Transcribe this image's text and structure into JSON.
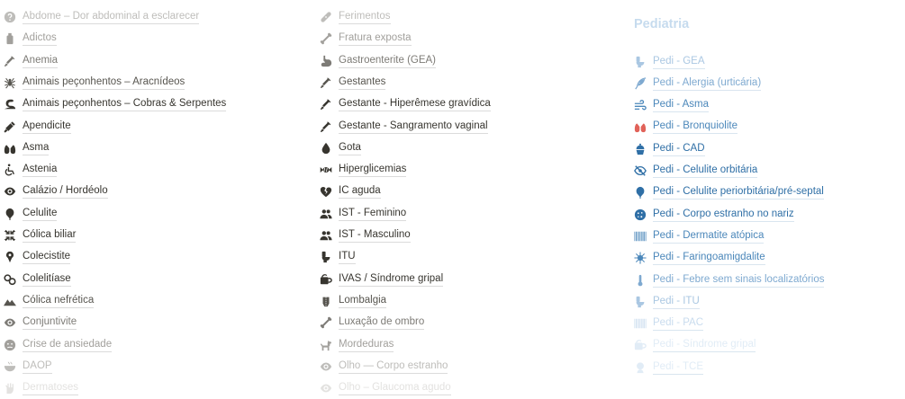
{
  "columns": [
    {
      "items": [
        {
          "label": "Abdome – Dor abdominal a esclarecer",
          "icon": "help-circle-icon"
        },
        {
          "label": "Adictos",
          "icon": "bottle-icon"
        },
        {
          "label": "Anemia",
          "icon": "syringe-icon"
        },
        {
          "label": "Animais peçonhentos – Aracnídeos",
          "icon": "spider-icon"
        },
        {
          "label": "Animais peçonhentos – Cobras & Serpentes",
          "icon": "snake-icon"
        },
        {
          "label": "Apendicite",
          "icon": "stethoscope-icon"
        },
        {
          "label": "Asma",
          "icon": "lungs-icon"
        },
        {
          "label": "Astenia",
          "icon": "wheelchair-icon"
        },
        {
          "label": "Calázio / Hordéolo",
          "icon": "eye-icon"
        },
        {
          "label": "Celulite",
          "icon": "balloon-icon"
        },
        {
          "label": "Cólica biliar",
          "icon": "compress-icon"
        },
        {
          "label": "Colecistite",
          "icon": "pin-icon"
        },
        {
          "label": "Colelitíase",
          "icon": "stones-icon"
        },
        {
          "label": "Cólica nefrética",
          "icon": "mountains-icon"
        },
        {
          "label": "Conjuntivite",
          "icon": "eye-icon"
        },
        {
          "label": "Crise de ansiedade",
          "icon": "face-icon"
        },
        {
          "label": "DAOP",
          "icon": "basin-icon"
        },
        {
          "label": "Dermatoses",
          "icon": "hand-icon"
        }
      ]
    },
    {
      "items": [
        {
          "label": "Ferimentos",
          "icon": "bandage-icon"
        },
        {
          "label": "Fratura exposta",
          "icon": "bone-icon"
        },
        {
          "label": "Gastroenterite (GEA)",
          "icon": "stomach-icon"
        },
        {
          "label": "Gestantes",
          "icon": "syringe-icon"
        },
        {
          "label": "Gestante - Hiperêmese gravídica",
          "icon": "syringe-icon"
        },
        {
          "label": "Gestante - Sangramento vaginal",
          "icon": "syringe-icon"
        },
        {
          "label": "Gota",
          "icon": "drop-icon"
        },
        {
          "label": "Hiperglicemias",
          "icon": "candy-icon"
        },
        {
          "label": "IC aguda",
          "icon": "broken-heart-icon"
        },
        {
          "label": "IST - Feminino",
          "icon": "users-icon"
        },
        {
          "label": "IST - Masculino",
          "icon": "users-icon"
        },
        {
          "label": "ITU",
          "icon": "toilet-icon"
        },
        {
          "label": "IVAS / Síndrome gripal",
          "icon": "tissue-icon"
        },
        {
          "label": "Lombalgia",
          "icon": "back-icon"
        },
        {
          "label": "Luxação de ombro",
          "icon": "bone-icon"
        },
        {
          "label": "Mordeduras",
          "icon": "dog-icon"
        },
        {
          "label": "Olho — Corpo estranho",
          "icon": "eye-icon"
        },
        {
          "label": "Olho – Glaucoma agudo",
          "icon": "eye-icon"
        }
      ]
    },
    {
      "title": "Pediatria",
      "items": [
        {
          "label": "Pedi - GEA",
          "icon": "toilet-icon"
        },
        {
          "label": "Pedi - Alergia (urticária)",
          "icon": "feather-icon"
        },
        {
          "label": "Pedi - Asma",
          "icon": "wind-icon"
        },
        {
          "label": "Pedi - Bronquiolite",
          "icon": "lungs-icon"
        },
        {
          "label": "Pedi - CAD",
          "icon": "cupcake-icon"
        },
        {
          "label": "Pedi - Celulite orbitária",
          "icon": "eye-slash-icon"
        },
        {
          "label": "Pedi - Celulite periorbitária/pré-septal",
          "icon": "balloon-icon"
        },
        {
          "label": "Pedi - Corpo estranho no nariz",
          "icon": "cookie-icon"
        },
        {
          "label": "Pedi - Dermatite atópica",
          "icon": "barcode-icon"
        },
        {
          "label": "Pedi - Faringoamigdalite",
          "icon": "virus-icon"
        },
        {
          "label": "Pedi - Febre sem sinais localizatórios",
          "icon": "thermometer-icon"
        },
        {
          "label": "Pedi - ITU",
          "icon": "toilet-icon"
        },
        {
          "label": "Pedi - PAC",
          "icon": "barcode-icon"
        },
        {
          "label": "Pedi - Síndrome gripal",
          "icon": "tissue-icon"
        },
        {
          "label": "Pedi - TCE",
          "icon": "head-icon"
        }
      ]
    }
  ],
  "colors": {
    "text": "#37352f",
    "pedi_accent": "#2f6fa6",
    "lungs_icon": "#e16259"
  }
}
